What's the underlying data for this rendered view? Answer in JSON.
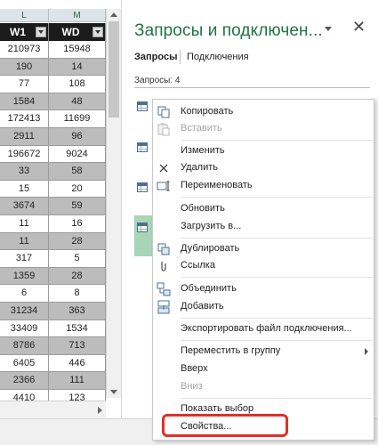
{
  "sheet": {
    "col_letters": [
      "L",
      "M"
    ],
    "headers": [
      "W1",
      "WD"
    ],
    "rows": [
      [
        "210973",
        "15948"
      ],
      [
        "190",
        "14"
      ],
      [
        "77",
        "108"
      ],
      [
        "1584",
        "48"
      ],
      [
        "172413",
        "11699"
      ],
      [
        "2911",
        "96"
      ],
      [
        "196672",
        "9024"
      ],
      [
        "33",
        "58"
      ],
      [
        "15",
        "20"
      ],
      [
        "3674",
        "59"
      ],
      [
        "11",
        "16"
      ],
      [
        "11",
        "28"
      ],
      [
        "317",
        "5"
      ],
      [
        "1359",
        "28"
      ],
      [
        "6",
        "8"
      ],
      [
        "31234",
        "363"
      ],
      [
        "33409",
        "1534"
      ],
      [
        "8786",
        "713"
      ],
      [
        "6405",
        "446"
      ],
      [
        "2366",
        "111"
      ],
      [
        "4410",
        "123"
      ]
    ]
  },
  "pane": {
    "title": "Запросы и подключен...",
    "close_icon": "close-icon",
    "menu_icon": "chevron-down-icon",
    "tabs": [
      "Запросы",
      "Подключения"
    ],
    "query_count": "Запросы: 4"
  },
  "context_menu": {
    "items": [
      {
        "label": "Копировать",
        "icon": "copy-icon",
        "enabled": true
      },
      {
        "label": "Вставить",
        "icon": "paste-icon",
        "enabled": false
      },
      {
        "label": "Изменить",
        "icon": "",
        "enabled": true
      },
      {
        "label": "Удалить",
        "icon": "delete-icon",
        "enabled": true
      },
      {
        "label": "Переименовать",
        "icon": "rename-icon",
        "enabled": true
      },
      {
        "label": "Обновить",
        "icon": "",
        "enabled": true
      },
      {
        "label": "Загрузить в...",
        "icon": "",
        "enabled": true
      },
      {
        "label": "Дублировать",
        "icon": "duplicate-icon",
        "enabled": true
      },
      {
        "label": "Ссылка",
        "icon": "link-icon",
        "enabled": true
      },
      {
        "label": "Объединить",
        "icon": "merge-icon",
        "enabled": true
      },
      {
        "label": "Добавить",
        "icon": "append-icon",
        "enabled": true
      },
      {
        "label": "Экспортировать файл подключения...",
        "icon": "",
        "enabled": true
      },
      {
        "label": "Переместить в группу",
        "icon": "",
        "enabled": true,
        "submenu": true
      },
      {
        "label": "Вверх",
        "icon": "",
        "enabled": true
      },
      {
        "label": "Вниз",
        "icon": "",
        "enabled": false
      },
      {
        "label": "Показать выбор",
        "icon": "",
        "enabled": true
      },
      {
        "label": "Свойства...",
        "icon": "",
        "enabled": true
      }
    ]
  },
  "colors": {
    "accent": "#217346",
    "highlight": "#e0302a",
    "selection": "#a8d5b5"
  }
}
